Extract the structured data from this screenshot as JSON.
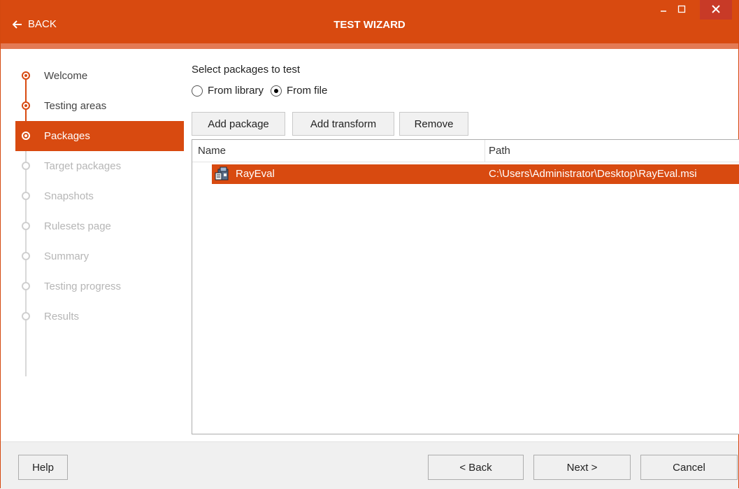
{
  "titlebar": {
    "back_label": "BACK",
    "title": "TEST WIZARD"
  },
  "colors": {
    "accent": "#d84a10",
    "accent_light": "#e37a55",
    "inactive_text": "#b6b6b6"
  },
  "sidebar": {
    "steps": [
      {
        "label": "Welcome",
        "state": "done"
      },
      {
        "label": "Testing areas",
        "state": "done"
      },
      {
        "label": "Packages",
        "state": "active"
      },
      {
        "label": "Target packages",
        "state": "inactive"
      },
      {
        "label": "Snapshots",
        "state": "inactive"
      },
      {
        "label": "Rulesets page",
        "state": "inactive"
      },
      {
        "label": "Summary",
        "state": "inactive"
      },
      {
        "label": "Testing progress",
        "state": "inactive"
      },
      {
        "label": "Results",
        "state": "inactive"
      }
    ]
  },
  "main": {
    "heading": "Select packages to test",
    "source_options": [
      {
        "label": "From library",
        "checked": false
      },
      {
        "label": "From file",
        "checked": true
      }
    ],
    "toolbar": {
      "add_package": "Add package",
      "add_transform": "Add transform",
      "remove": "Remove"
    },
    "table": {
      "columns": [
        "Name",
        "Path"
      ],
      "rows": [
        {
          "name": "RayEval",
          "path": "C:\\Users\\Administrator\\Desktop\\RayEval.msi",
          "icon": "msi-package-icon",
          "selected": true
        }
      ]
    }
  },
  "footer": {
    "help": "Help",
    "back": "< Back",
    "next": "Next >",
    "cancel": "Cancel"
  }
}
